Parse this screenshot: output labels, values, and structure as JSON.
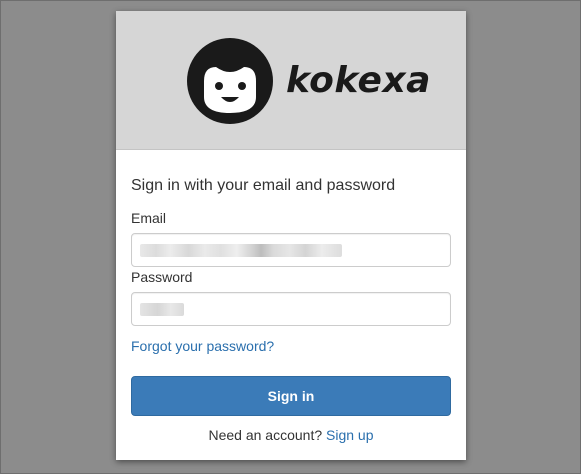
{
  "brand": {
    "name": "kokexa",
    "logo_icon": "smiling-face-logo-icon"
  },
  "login": {
    "heading": "Sign in with your email and password",
    "email_label": "Email",
    "email_value": "",
    "password_label": "Password",
    "password_value": "",
    "forgot_link": "Forgot your password?",
    "signin_button": "Sign in",
    "signup_prompt": "Need an account?",
    "signup_link": "Sign up"
  },
  "colors": {
    "background": "#8c8c8c",
    "banner": "#d6d6d6",
    "primary_button": "#3b7bb8",
    "link": "#2a6fad"
  }
}
